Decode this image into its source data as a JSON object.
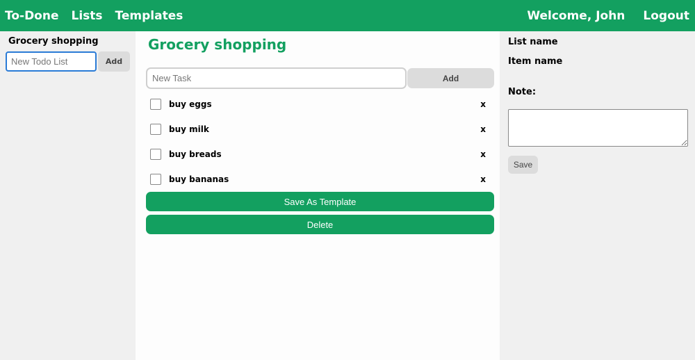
{
  "nav": {
    "brand": "To-Done",
    "lists": "Lists",
    "templates": "Templates",
    "welcome": "Welcome, John",
    "logout": "Logout"
  },
  "sidebar": {
    "lists": [
      {
        "label": "Grocery shopping"
      }
    ],
    "new_list_placeholder": "New Todo List",
    "add_label": "Add"
  },
  "main": {
    "title": "Grocery shopping",
    "new_task_placeholder": "New Task",
    "add_label": "Add",
    "tasks": [
      {
        "label": "buy eggs",
        "checked": false,
        "delete_label": "x"
      },
      {
        "label": "buy milk",
        "checked": false,
        "delete_label": "x"
      },
      {
        "label": "buy breads",
        "checked": false,
        "delete_label": "x"
      },
      {
        "label": "buy bananas",
        "checked": false,
        "delete_label": "x"
      }
    ],
    "save_template_label": "Save As Template",
    "delete_label": "Delete"
  },
  "detail": {
    "list_name_label": "List name",
    "item_name_label": "Item name",
    "note_label": "Note:",
    "note_value": "",
    "save_label": "Save"
  },
  "colors": {
    "accent": "#13a060",
    "button_gray": "#dcdcdc",
    "focus_border": "#2a7bd6"
  }
}
